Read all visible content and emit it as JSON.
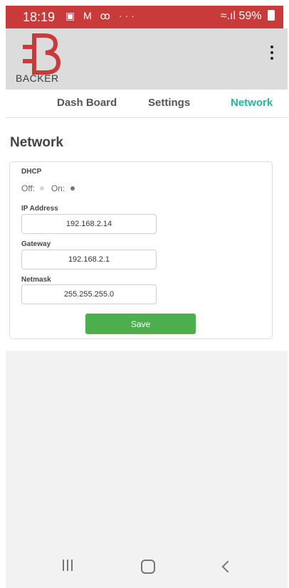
{
  "status_bar": {
    "time": "18:19",
    "left_icons": "▣ M ꝏ ···",
    "right_icons": "≈.ıl",
    "battery": "59%",
    "color": "#c93a3a"
  },
  "header": {
    "logo_text": "BACKER",
    "logo_color": "#c93a3a",
    "menu_icon": "kebab-menu-icon"
  },
  "tabs": [
    {
      "label": "Dash Board",
      "active": false
    },
    {
      "label": "Settings",
      "active": false
    },
    {
      "label": "Network",
      "active": true
    }
  ],
  "accent_color": "#2bb2a1",
  "page": {
    "title": "Network"
  },
  "form": {
    "dhcp_label": "DHCP",
    "dhcp_off_label": "Off:",
    "dhcp_on_label": "On:",
    "dhcp_selected": "On",
    "ip_label": "IP Address",
    "ip_value": "192.168.2.14",
    "gateway_label": "Gateway",
    "gateway_value": "192.168.2.1",
    "netmask_label": "Netmask",
    "netmask_value": "255.255.255.0",
    "save_label": "Save",
    "save_color": "#4cae4c"
  },
  "nav_bar": {
    "recents_icon": "recents-icon",
    "home_icon": "home-icon",
    "back_icon": "back-icon"
  }
}
